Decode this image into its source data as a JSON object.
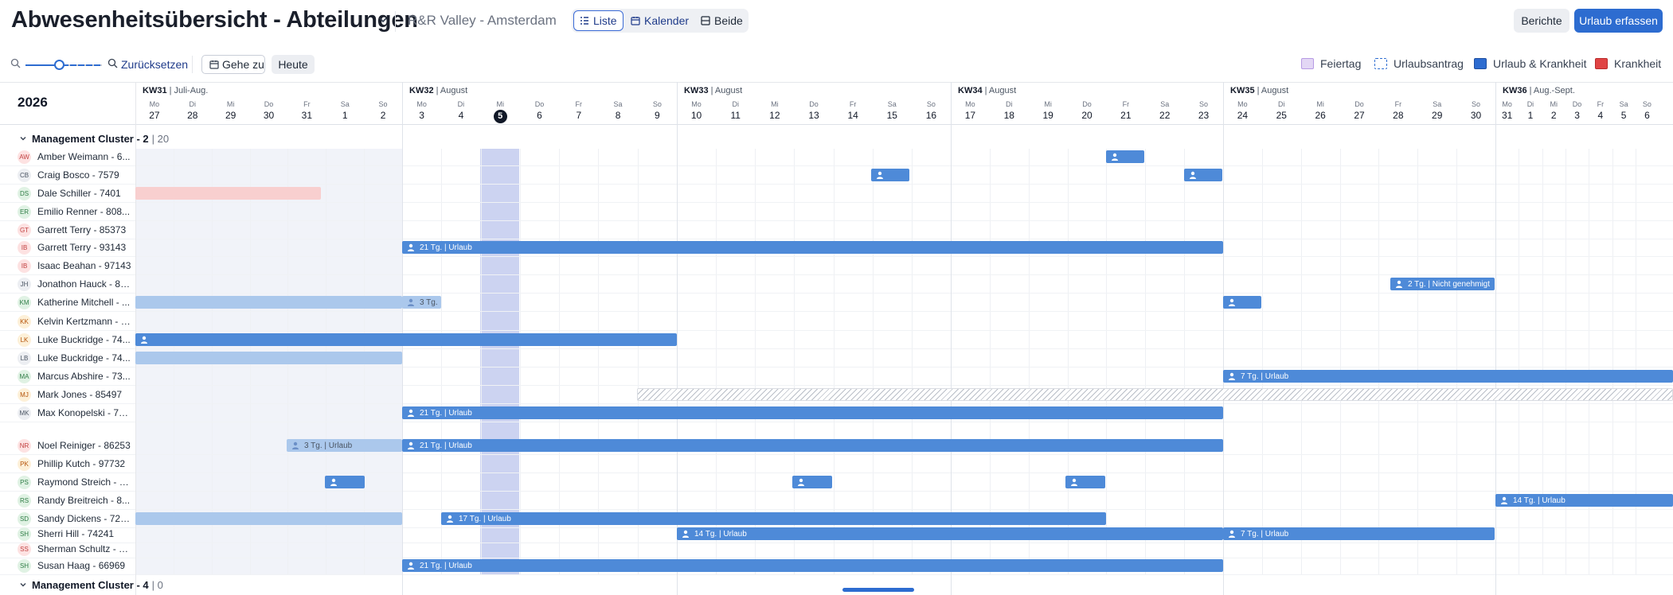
{
  "header": {
    "title": "Abwesenheitsübersicht - Abteilungen",
    "subtitle": "R&R Valley - Amsterdam",
    "views": [
      "Liste",
      "Kalender",
      "Beide"
    ],
    "reports": "Berichte",
    "primary": "Urlaub erfassen"
  },
  "toolbar": {
    "reset": "Zurücksetzen",
    "goto": "Gehe zu",
    "today": "Heute",
    "legend": [
      "Feiertag",
      "Urlaubsantrag",
      "Urlaub & Krankheit",
      "Krankheit"
    ]
  },
  "timeline": {
    "year": "2026",
    "weeks": [
      {
        "kw": "KW31",
        "month": "Juli-Aug."
      },
      {
        "kw": "KW32",
        "month": "August"
      },
      {
        "kw": "KW33",
        "month": "August"
      },
      {
        "kw": "KW34",
        "month": "August"
      },
      {
        "kw": "KW35",
        "month": "August"
      },
      {
        "kw": "KW36",
        "month": "Aug.-Sept."
      }
    ],
    "dow": [
      "Mo",
      "Di",
      "Mi",
      "Do",
      "Fr",
      "Sa",
      "So"
    ],
    "days": [
      "27",
      "28",
      "29",
      "30",
      "31",
      "1",
      "2",
      "3",
      "4",
      "5",
      "6",
      "7",
      "8",
      "9",
      "10",
      "11",
      "12",
      "13",
      "14",
      "15",
      "16",
      "17",
      "18",
      "19",
      "20",
      "21",
      "22",
      "23",
      "24",
      "25",
      "26",
      "27",
      "28",
      "29",
      "30",
      "31",
      "1",
      "2",
      "3",
      "4",
      "5",
      "6"
    ],
    "today": "5"
  },
  "groups": [
    {
      "name": "Management Cluster - 2",
      "count": "20"
    },
    {
      "name": "Management Cluster - 4",
      "count": "0"
    }
  ],
  "people": [
    {
      "initials": "AW",
      "name": "Amber Weimann - 6..."
    },
    {
      "initials": "CB",
      "name": "Craig Bosco - 7579"
    },
    {
      "initials": "DS",
      "name": "Dale Schiller - 7401"
    },
    {
      "initials": "ER",
      "name": "Emilio Renner - 808..."
    },
    {
      "initials": "GT",
      "name": "Garrett Terry - 85373"
    },
    {
      "initials": "IB",
      "name": "Garrett Terry - 93143"
    },
    {
      "initials": "IB",
      "name": "Isaac Beahan - 97143"
    },
    {
      "initials": "JH",
      "name": "Jonathon Hauck - 86..."
    },
    {
      "initials": "KM",
      "name": "Katherine Mitchell - ..."
    },
    {
      "initials": "KK",
      "name": "Kelvin Kertzmann - 7..."
    },
    {
      "initials": "LK",
      "name": "Luke Buckridge - 74..."
    },
    {
      "initials": "LB",
      "name": "Luke Buckridge - 74..."
    },
    {
      "initials": "MA",
      "name": "Marcus Abshire - 73..."
    },
    {
      "initials": "MJ",
      "name": "Mark Jones - 85497"
    },
    {
      "initials": "MK",
      "name": "Max Konopelski - 73..."
    },
    {
      "initials": "NR",
      "name": "Noel Reiniger - 86253"
    },
    {
      "initials": "PK",
      "name": "Phillip Kutch - 97732"
    },
    {
      "initials": "PS",
      "name": "Raymond Streich - 8..."
    },
    {
      "initials": "RS",
      "name": "Randy Breitreich - 8..."
    },
    {
      "initials": "SD",
      "name": "Sandy Dickens - 726..."
    },
    {
      "initials": "SH",
      "name": "Sherri Hill - 74241"
    },
    {
      "initials": "SS",
      "name": "Sherman Schultz - 8..."
    },
    {
      "initials": "SH",
      "name": "Susan Haag - 66969"
    }
  ],
  "bars": [
    {
      "label": "21 Tg. | Urlaub"
    },
    {
      "label": "3 Tg."
    },
    {
      "label": "2 Tg. | Nicht genehmigt"
    },
    {
      "label": "7 Tg. | Urlaub"
    },
    {
      "label": "21 Tg. | Urlaub"
    },
    {
      "label": "3 Tg. | Urlaub"
    },
    {
      "label": "21 Tg. | Urlaub"
    },
    {
      "label": "14 Tg. | Urlaub"
    },
    {
      "label": "17 Tg. | Urlaub"
    },
    {
      "label": "14 Tg. | Urlaub"
    },
    {
      "label": "7 Tg. | Urlaub"
    },
    {
      "label": "21 Tg. | Urlaub"
    }
  ],
  "colors": {
    "primary": "#2d6cd0",
    "bar": "#4e8ad8",
    "bar_light": "#abc8ec",
    "sick": "#f8cfcf",
    "today_col": "#ccd3f1"
  }
}
